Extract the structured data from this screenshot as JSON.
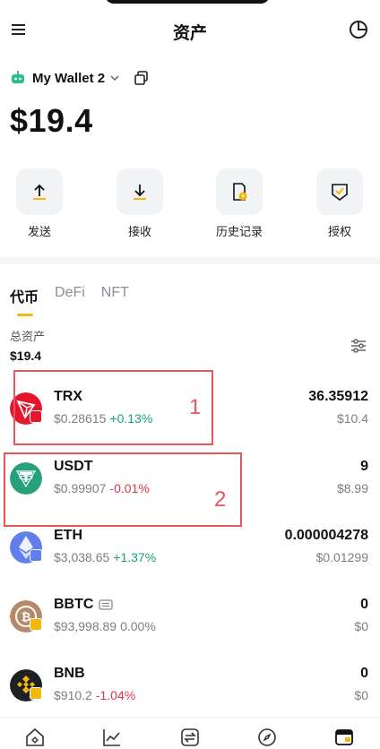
{
  "header": {
    "title": "资产"
  },
  "wallet": {
    "name": "My Wallet 2",
    "balance": "$19.4"
  },
  "actions": [
    {
      "label": "发送",
      "icon": "send-icon"
    },
    {
      "label": "接收",
      "icon": "receive-icon"
    },
    {
      "label": "历史记录",
      "icon": "history-icon"
    },
    {
      "label": "授权",
      "icon": "authorize-icon"
    }
  ],
  "tabs": [
    {
      "label": "代币",
      "active": true
    },
    {
      "label": "DeFi",
      "active": false
    },
    {
      "label": "NFT",
      "active": false
    }
  ],
  "total": {
    "label": "总资产",
    "value": "$19.4"
  },
  "tokens": [
    {
      "symbol": "TRX",
      "price": "$0.28615",
      "change": "+0.13%",
      "trend": "up",
      "amount": "36.35912",
      "value": "$10.4"
    },
    {
      "symbol": "USDT",
      "price": "$0.99907",
      "change": "-0.01%",
      "trend": "down",
      "amount": "9",
      "value": "$8.99"
    },
    {
      "symbol": "ETH",
      "price": "$3,038.65",
      "change": "+1.37%",
      "trend": "up",
      "amount": "0.000004278",
      "value": "$0.01299"
    },
    {
      "symbol": "BBTC",
      "price": "$93,998.89",
      "change": "0.00%",
      "trend": "flat",
      "amount": "0",
      "value": "$0"
    },
    {
      "symbol": "BNB",
      "price": "$910.2",
      "change": "-1.04%",
      "trend": "down",
      "amount": "0",
      "value": "$0"
    }
  ],
  "annotations": [
    {
      "label": "1"
    },
    {
      "label": "2"
    }
  ],
  "colors": {
    "accent": "#f0b90b",
    "up": "#18a56b",
    "down": "#e5354d",
    "annotation": "#e8565c"
  }
}
